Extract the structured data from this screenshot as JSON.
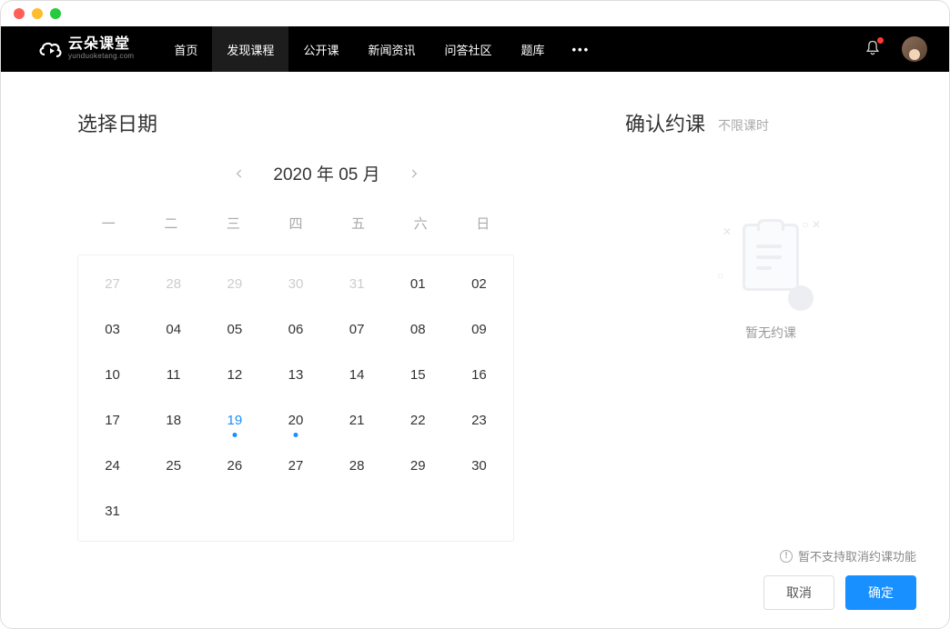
{
  "logo": {
    "main": "云朵课堂",
    "sub": "yunduoketang.com"
  },
  "nav": {
    "items": [
      {
        "label": "首页"
      },
      {
        "label": "发现课程",
        "active": true
      },
      {
        "label": "公开课"
      },
      {
        "label": "新闻资讯"
      },
      {
        "label": "问答社区"
      },
      {
        "label": "题库"
      }
    ],
    "more": "•••"
  },
  "left": {
    "title": "选择日期",
    "month_label": "2020 年 05 月",
    "weekdays": [
      "一",
      "二",
      "三",
      "四",
      "五",
      "六",
      "日"
    ],
    "chart_data": {
      "type": "table",
      "year": 2020,
      "month": 5,
      "selected_day": 19,
      "event_days": [
        19,
        20
      ],
      "grid": [
        [
          {
            "d": "27",
            "other": true
          },
          {
            "d": "28",
            "other": true
          },
          {
            "d": "29",
            "other": true
          },
          {
            "d": "30",
            "other": true
          },
          {
            "d": "31",
            "other": true
          },
          {
            "d": "01"
          },
          {
            "d": "02"
          }
        ],
        [
          {
            "d": "03"
          },
          {
            "d": "04"
          },
          {
            "d": "05"
          },
          {
            "d": "06"
          },
          {
            "d": "07"
          },
          {
            "d": "08"
          },
          {
            "d": "09"
          }
        ],
        [
          {
            "d": "10"
          },
          {
            "d": "11"
          },
          {
            "d": "12"
          },
          {
            "d": "13"
          },
          {
            "d": "14"
          },
          {
            "d": "15"
          },
          {
            "d": "16"
          },
          {
            "d": "17"
          }
        ],
        [
          {
            "d": "18"
          },
          {
            "d": "19",
            "selected": true,
            "dot": true
          },
          {
            "d": "20",
            "dot": true
          },
          {
            "d": "21"
          },
          {
            "d": "22"
          },
          {
            "d": "23"
          },
          {
            "d": "24"
          }
        ],
        [
          {
            "d": "25"
          },
          {
            "d": "26"
          },
          {
            "d": "27"
          },
          {
            "d": "28"
          },
          {
            "d": "29"
          },
          {
            "d": "30"
          },
          {
            "d": "31"
          }
        ]
      ],
      "flat": [
        {
          "d": "27",
          "other": true
        },
        {
          "d": "28",
          "other": true
        },
        {
          "d": "29",
          "other": true
        },
        {
          "d": "30",
          "other": true
        },
        {
          "d": "31",
          "other": true
        },
        {
          "d": "01"
        },
        {
          "d": "02"
        },
        {
          "d": "03"
        },
        {
          "d": "04"
        },
        {
          "d": "05"
        },
        {
          "d": "06"
        },
        {
          "d": "07"
        },
        {
          "d": "08"
        },
        {
          "d": "09"
        },
        {
          "d": "10"
        },
        {
          "d": "11"
        },
        {
          "d": "12"
        },
        {
          "d": "13"
        },
        {
          "d": "14"
        },
        {
          "d": "15"
        },
        {
          "d": "16"
        },
        {
          "d": "17"
        },
        {
          "d": "18"
        },
        {
          "d": "19",
          "selected": true,
          "dot": true
        },
        {
          "d": "20",
          "dot": true
        },
        {
          "d": "21"
        },
        {
          "d": "22"
        },
        {
          "d": "23"
        },
        {
          "d": "24"
        },
        {
          "d": "25"
        },
        {
          "d": "26"
        },
        {
          "d": "27"
        },
        {
          "d": "28"
        },
        {
          "d": "29"
        },
        {
          "d": "30"
        },
        {
          "d": "31"
        }
      ]
    }
  },
  "right": {
    "title": "确认约课",
    "subtitle": "不限课时",
    "empty_text": "暂无约课",
    "note": "暂不支持取消约课功能",
    "cancel": "取消",
    "confirm": "确定"
  }
}
